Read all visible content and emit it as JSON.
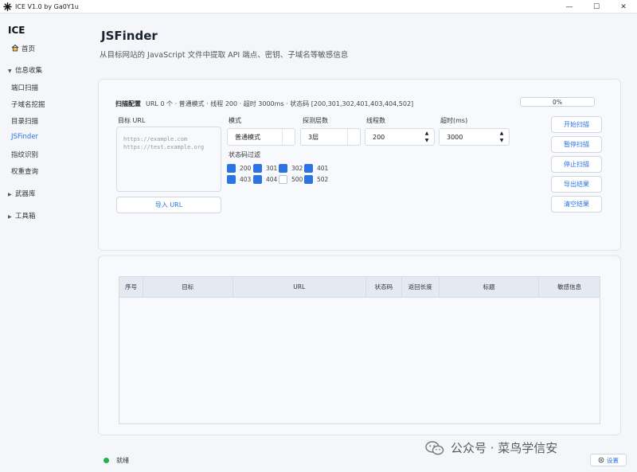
{
  "window": {
    "title": "ICE V1.0 by Ga0Y1u",
    "controls": [
      "—",
      "☐",
      "✕"
    ]
  },
  "sidebar": {
    "logo": "ICE",
    "home": "首页",
    "groups": [
      {
        "label": "信息收集",
        "expanded": true,
        "items": [
          "端口扫描",
          "子域名挖掘",
          "目录扫描",
          "JSFinder",
          "指纹识别",
          "权重查询"
        ]
      },
      {
        "label": "武器库",
        "expanded": false
      },
      {
        "label": "工具箱",
        "expanded": false
      }
    ],
    "active_item": "JSFinder"
  },
  "page": {
    "title": "JSFinder",
    "subtitle": "从目标网站的 JavaScript 文件中提取 API 端点、密钥、子域名等敏感信息"
  },
  "config": {
    "heading": "扫描配置",
    "summary": "URL 0 个 · 普通模式 · 线程 200 · 超时 3000ms · 状态码 [200,301,302,401,403,404,502]",
    "progress_text": "0%",
    "progress_value": 0,
    "target_label": "目标 URL",
    "target_placeholder": "https://example.com\nhttps://test.example.org",
    "import_button": "导入 URL",
    "mode_label": "模式",
    "mode_value": "普通模式",
    "depth_label": "探测层数",
    "depth_value": "3层",
    "threads_label": "线程数",
    "threads_value": "200",
    "timeout_label": "超时(ms)",
    "timeout_value": "3000",
    "status_filter_label": "状态码过滤",
    "status_codes": [
      {
        "code": "200",
        "checked": true
      },
      {
        "code": "301",
        "checked": true
      },
      {
        "code": "302",
        "checked": true
      },
      {
        "code": "401",
        "checked": true
      },
      {
        "code": "403",
        "checked": true
      },
      {
        "code": "404",
        "checked": true
      },
      {
        "code": "500",
        "checked": false
      },
      {
        "code": "502",
        "checked": true
      }
    ]
  },
  "actions": {
    "start": "开始扫描",
    "pause": "暂停扫描",
    "stop": "停止扫描",
    "export": "导出结果",
    "clear": "清空结果"
  },
  "table": {
    "columns": [
      "序号",
      "目标",
      "URL",
      "状态码",
      "返回长度",
      "标题",
      "敏感信息"
    ],
    "rows": []
  },
  "status_bar": {
    "status": "就绪",
    "status_color": "#22b04b",
    "settings": "设置",
    "watermark": "公众号 · 菜鸟学信安"
  },
  "colors": {
    "accent": "#2b74e4",
    "background": "#f4f6fa"
  }
}
